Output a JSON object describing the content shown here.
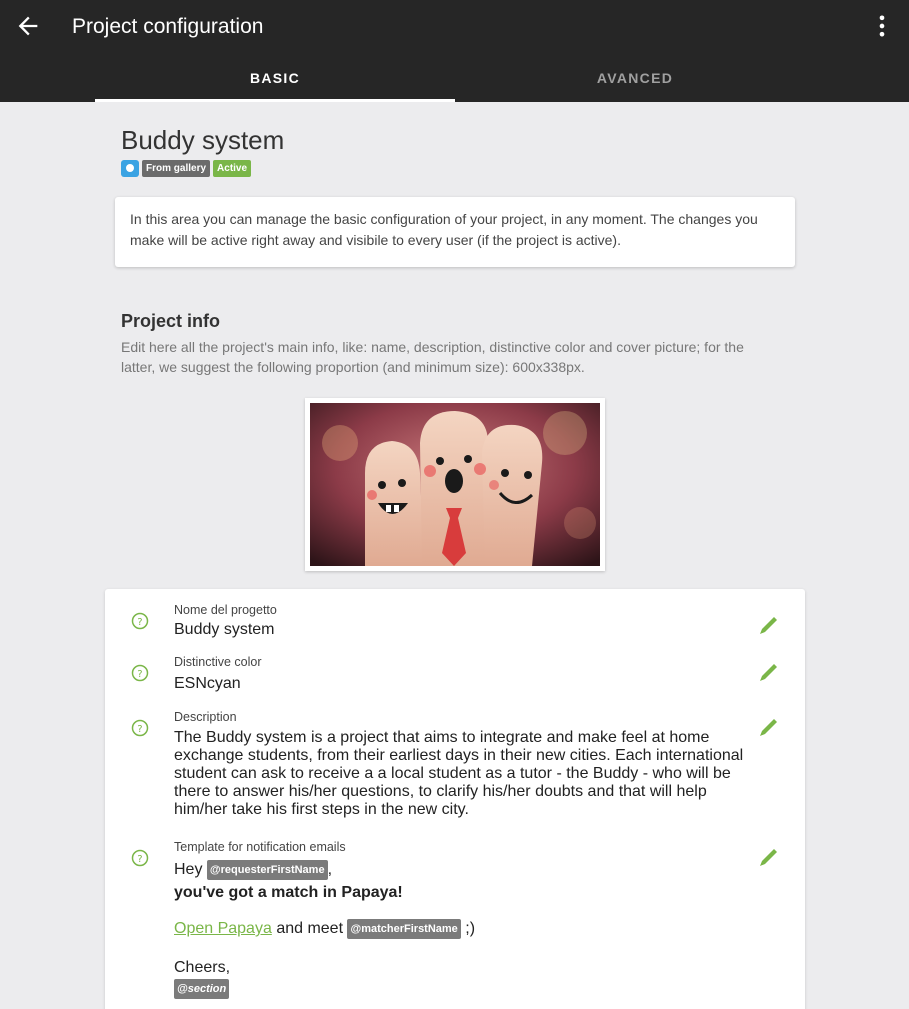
{
  "appbar": {
    "title": "Project configuration",
    "back_icon": "arrow-left-icon",
    "menu_icon": "more-vert-icon"
  },
  "tabs": [
    {
      "label": "BASIC",
      "selected": true
    },
    {
      "label": "AVANCED",
      "selected": false
    }
  ],
  "project": {
    "name": "Buddy system",
    "badges": {
      "gallery": "From gallery",
      "active": "Active"
    },
    "info": "In this area you can manage the basic configuration of your project, in any moment. The changes you make will be active right away and visibile to every user (if the project is active)."
  },
  "project_info": {
    "title": "Project info",
    "description": "Edit here all the project's main info, like: name, description, distinctive color and cover picture; for the latter, we suggest the following proportion (and minimum size): 600x338px."
  },
  "fields": {
    "name": {
      "label": "Nome del progetto",
      "value": "Buddy system"
    },
    "color": {
      "label": "Distinctive color",
      "value": "ESNcyan"
    },
    "description": {
      "label": "Description",
      "value": "The Buddy system is a project that aims to integrate and make feel at home exchange students, from their earliest days in their new cities. Each international student can ask to receive a a local student as a tutor - the Buddy - who will be there to answer his/her questions, to clarify his/her doubts and that will help him/her take his first steps in the new city."
    },
    "template": {
      "label": "Template for notification emails",
      "greeting": "Hey",
      "requester_tag": "@requesterFirstName",
      "comma": ",",
      "headline": "you've got a match in Papaya!",
      "link_text": "Open Papaya",
      "meet_text": "and meet",
      "matcher_tag": "@matcherFirstName",
      "smiley": ";)",
      "signoff": "Cheers,",
      "section_tag": "@section"
    }
  },
  "colors": {
    "appbar": "#262626",
    "accent_green": "#7ab648",
    "badge_blue": "#3aa3e3"
  }
}
